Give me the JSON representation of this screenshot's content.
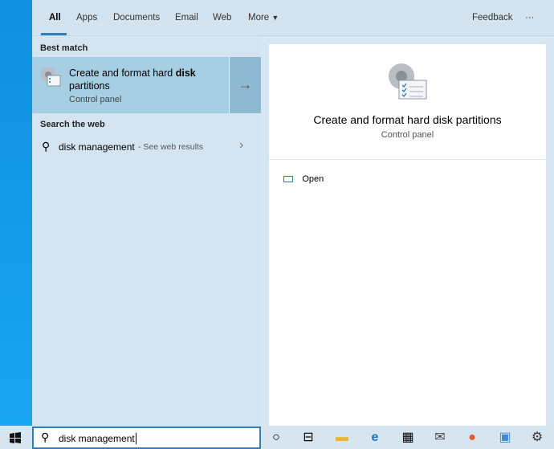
{
  "tabs": [
    "All",
    "Apps",
    "Documents",
    "Email",
    "Web",
    "More"
  ],
  "feedback": "Feedback",
  "ellipsis": "···",
  "best_match": {
    "header": "Best match",
    "title_plain": "Create and format hard ",
    "title_bold": "disk",
    "title_line2": "partitions",
    "subtitle": "Control panel"
  },
  "web": {
    "header": "Search the web",
    "query": "disk management",
    "suffix": " - See web results"
  },
  "preview": {
    "title": "Create and format hard disk partitions",
    "subtitle": "Control panel",
    "open": "Open"
  },
  "search": {
    "value": "disk management"
  },
  "accent": "#2f7fbf"
}
